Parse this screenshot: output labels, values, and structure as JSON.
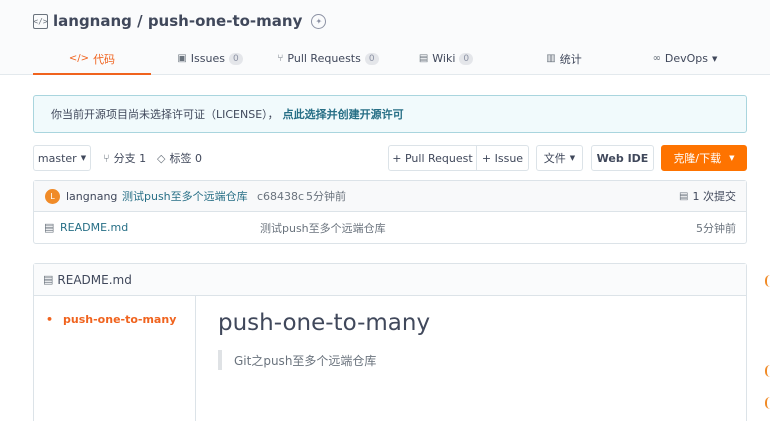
{
  "repo": {
    "name": "langnang / push-one-to-many"
  },
  "tabs": [
    {
      "label": "代码",
      "icon": "code-icon"
    },
    {
      "label": "Issues",
      "count": "0",
      "icon": "issues-icon"
    },
    {
      "label": "Pull Requests",
      "count": "0",
      "icon": "pull-request-icon"
    },
    {
      "label": "Wiki",
      "count": "0",
      "icon": "wiki-icon"
    },
    {
      "label": "统计",
      "icon": "stats-icon"
    },
    {
      "label": "DevOps",
      "icon": "devops-icon"
    }
  ],
  "notice": {
    "text": "你当前开源项目尚未选择许可证（LICENSE），",
    "link": "点此选择并创建开源许可"
  },
  "toolbar": {
    "branch": "master",
    "branches": "分支 1",
    "tags": "标签 0",
    "pull_request": "+ Pull Request",
    "issue": "+ Issue",
    "file": "文件",
    "web_ide": "Web IDE",
    "clone": "克隆/下载"
  },
  "commit": {
    "avatar": "L",
    "author": "langnang",
    "message": "测试push至多个远端仓库",
    "sha": "c68438c",
    "time": "5分钟前",
    "count": "1 次提交"
  },
  "files": [
    {
      "name": "README.md",
      "message": "测试push至多个远端仓库",
      "time": "5分钟前"
    }
  ],
  "readme": {
    "filename": "README.md",
    "toc": [
      "push-one-to-many"
    ],
    "title": "push-one-to-many",
    "quote": "Git之push至多个远端仓库"
  },
  "colors": {
    "accent": "#f0631e",
    "clone_button": "#fe7300",
    "link": "#276f86"
  }
}
